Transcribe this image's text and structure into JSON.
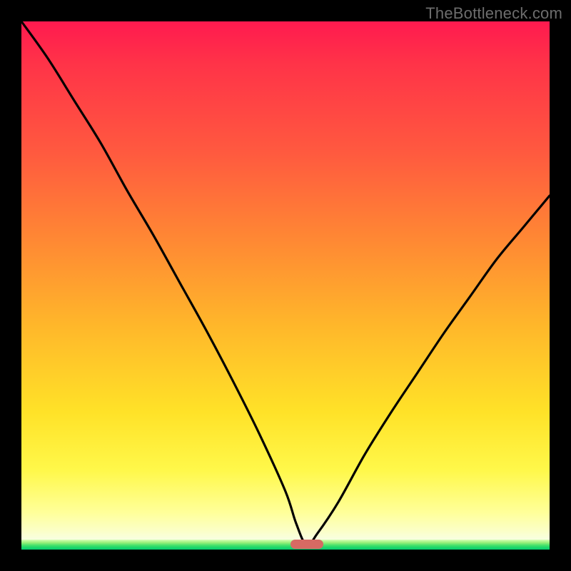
{
  "watermark": "TheBottleneck.com",
  "chart_data": {
    "type": "line",
    "title": "",
    "xlabel": "",
    "ylabel": "",
    "xlim": [
      0,
      100
    ],
    "ylim": [
      0,
      100
    ],
    "grid": false,
    "legend": false,
    "series": [
      {
        "name": "curve",
        "x": [
          0,
          5,
          10,
          15,
          20,
          25,
          30,
          35,
          40,
          45,
          50,
          52,
          54,
          56,
          60,
          65,
          70,
          75,
          80,
          85,
          90,
          95,
          100
        ],
        "y": [
          100,
          93,
          85,
          77,
          68,
          59.5,
          50.5,
          41.5,
          32,
          22,
          11,
          5,
          0.8,
          3,
          9,
          18,
          26,
          33.5,
          41,
          48,
          55,
          61,
          67
        ]
      }
    ],
    "marker": {
      "x_center": 54,
      "y": 0,
      "color": "#d76a63"
    },
    "background_gradient": {
      "orientation": "vertical",
      "stops": [
        {
          "pct": 0,
          "color": "#ff1a4f"
        },
        {
          "pct": 25,
          "color": "#ff5a3f"
        },
        {
          "pct": 58,
          "color": "#ffb82a"
        },
        {
          "pct": 85,
          "color": "#fff84a"
        },
        {
          "pct": 98,
          "color": "#f8ffe0"
        },
        {
          "pct": 100,
          "color": "#0acb6e"
        }
      ]
    }
  }
}
